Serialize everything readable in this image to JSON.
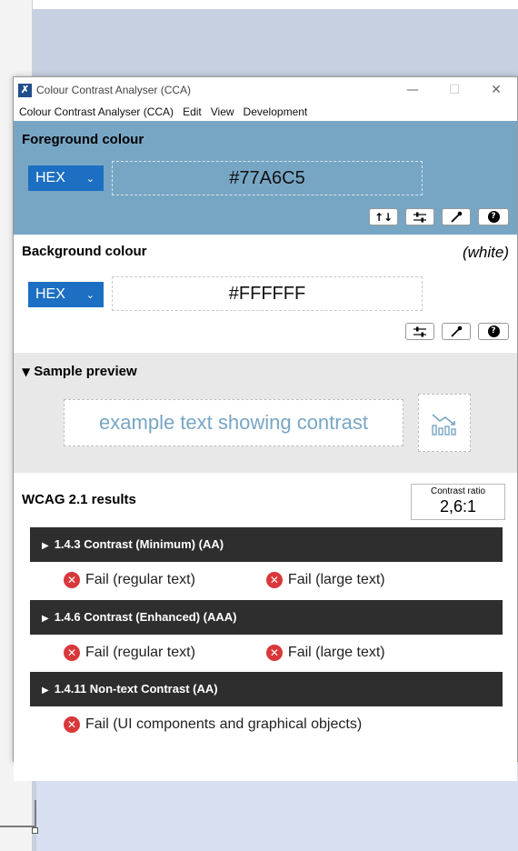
{
  "window": {
    "title": "Colour Contrast Analyser (CCA)",
    "controls": {
      "minimize": "—",
      "maximize": "☐",
      "close": "✕"
    }
  },
  "menu": [
    "Colour Contrast Analyser (CCA)",
    "Edit",
    "View",
    "Development"
  ],
  "foreground": {
    "title": "Foreground colour",
    "format": "HEX",
    "value": "#77A6C5",
    "color": "#77A6C5",
    "tools": [
      "swap-icon",
      "sliders-icon",
      "eyedropper-icon",
      "help-icon"
    ]
  },
  "background": {
    "title": "Background colour",
    "name": "(white)",
    "format": "HEX",
    "value": "#FFFFFF",
    "tools": [
      "sliders-icon",
      "eyedropper-icon",
      "help-icon"
    ]
  },
  "preview": {
    "title": "Sample preview",
    "sample_text": "example text showing contrast"
  },
  "results": {
    "title": "WCAG 2.1 results",
    "ratio_label": "Contrast ratio",
    "ratio_value": "2,6:1",
    "criteria": [
      {
        "label": "1.4.3 Contrast (Minimum) (AA)",
        "results": [
          "Fail (regular text)",
          "Fail (large text)"
        ]
      },
      {
        "label": "1.4.6 Contrast (Enhanced) (AAA)",
        "results": [
          "Fail (regular text)",
          "Fail (large text)"
        ]
      },
      {
        "label": "1.4.11 Non-text Contrast (AA)",
        "results": [
          "Fail (UI components and graphical objects)"
        ]
      }
    ]
  },
  "colors": {
    "foreground_panel": "#77A6C5",
    "format_select": "#1C6FC2",
    "criteria_bar": "#2E2E2E",
    "fail": "#D9383A"
  }
}
